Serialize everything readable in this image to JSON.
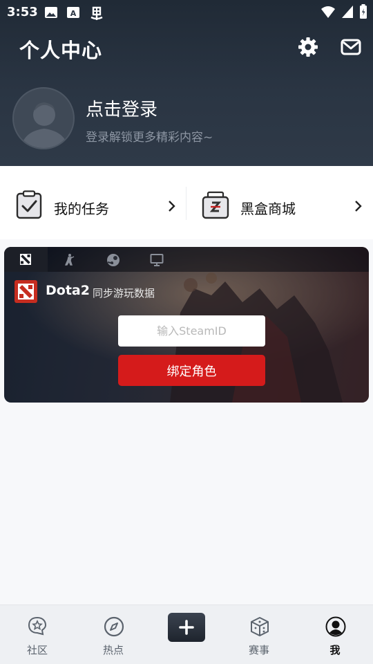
{
  "status_bar": {
    "time": "3:53",
    "icons": [
      "image-icon",
      "a-notification-icon",
      "bug-icon",
      "wifi-icon",
      "signal-icon",
      "battery-icon"
    ]
  },
  "header": {
    "title": "个人中心",
    "settings_icon": "gear-icon",
    "mail_icon": "mail-icon"
  },
  "profile": {
    "login_title": "点击登录",
    "login_subtitle": "登录解锁更多精彩内容~"
  },
  "quick_links": [
    {
      "label": "我的任务",
      "icon": "task-clipboard-icon"
    },
    {
      "label": "黑盒商城",
      "icon": "shop-box-icon"
    }
  ],
  "game_card": {
    "tabs": [
      {
        "icon": "dota-icon",
        "active": true
      },
      {
        "icon": "csgo-icon",
        "active": false
      },
      {
        "icon": "steam-icon",
        "active": false
      },
      {
        "icon": "monitor-icon",
        "active": false
      }
    ],
    "game_name": "Dota2",
    "game_subtitle": "同步游玩数据",
    "input_placeholder": "输入SteamID",
    "bind_label": "绑定角色"
  },
  "bottom_nav": [
    {
      "label": "社区",
      "icon": "community-star-icon",
      "active": false
    },
    {
      "label": "热点",
      "icon": "compass-icon",
      "active": false
    },
    {
      "label": "",
      "icon": "plus-icon",
      "active": false
    },
    {
      "label": "赛事",
      "icon": "cube-icon",
      "active": false
    },
    {
      "label": "我",
      "icon": "profile-icon",
      "active": true
    }
  ],
  "colors": {
    "header_bg": "#2a3543",
    "accent_red": "#d51b1b",
    "page_bg": "#f7f8fa"
  }
}
